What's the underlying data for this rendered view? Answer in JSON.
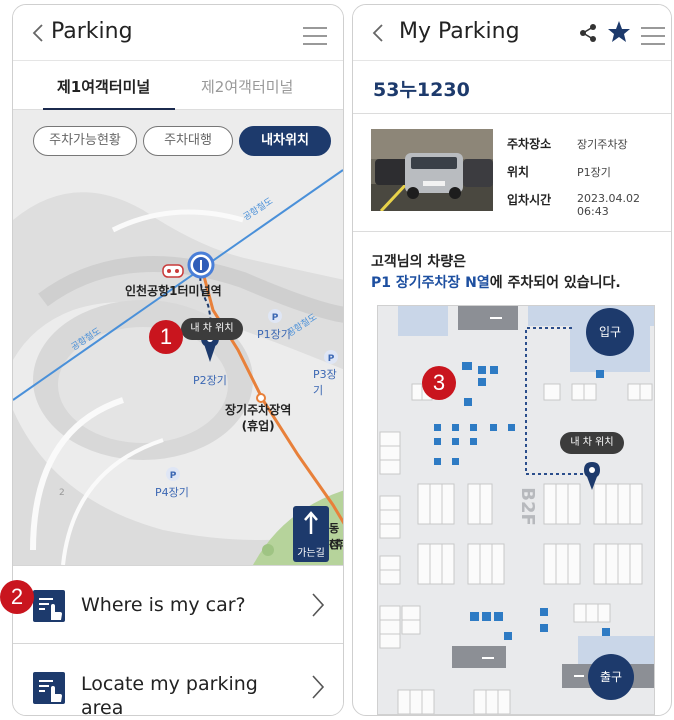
{
  "left": {
    "header": {
      "title": "Parking"
    },
    "tabs": [
      {
        "label": "제1여객터미널",
        "active": true
      },
      {
        "label": "제2여객터미널",
        "active": false
      }
    ],
    "chips": [
      {
        "label": "주차가능현황"
      },
      {
        "label": "주차대행"
      },
      {
        "label": "내차위치",
        "active": true
      }
    ],
    "map": {
      "station1": "인천공항1터미널역",
      "station2_line1": "장기주차장역",
      "station2_line2": "(휴업)",
      "road1": "공항철도",
      "road2": "공항철도",
      "road3": "공항철도",
      "car_tooltip": "내 차 위치",
      "lots": {
        "p1": "P1장기",
        "p2": "P2장기",
        "p3": "P3장기",
        "p4": "P4장기"
      },
      "walk_label": "가는길",
      "edge_label1": "동청",
      "edge_label2": "(휴"
    },
    "badges": {
      "b1": "1",
      "b2": "2"
    },
    "items": [
      {
        "label": "Where is my car?"
      },
      {
        "label_line1": "Locate my parking",
        "label_line2": "area"
      }
    ]
  },
  "right": {
    "header": {
      "title": "My Parking"
    },
    "plate": "53누1230",
    "info": [
      {
        "label": "주차장소",
        "value": "장기주차장"
      },
      {
        "label": "위치",
        "value": "P1장기"
      },
      {
        "label": "입차시간",
        "value": "2023.04.02 06:43"
      }
    ],
    "message_line1": "고객님의 차량은",
    "message_highlight": "P1 장기주차장 N열",
    "message_rest": "에 주차되어 있습니다.",
    "floor": {
      "entrance": "입구",
      "exit": "출구",
      "car_tooltip": "내 차 위치",
      "level": "B2F"
    },
    "badges": {
      "b3": "3"
    }
  },
  "colors": {
    "navy": "#1d3a6c",
    "badge_red": "#c9151e",
    "route_orange": "#e8803a",
    "rail_blue": "#4a90d9"
  }
}
